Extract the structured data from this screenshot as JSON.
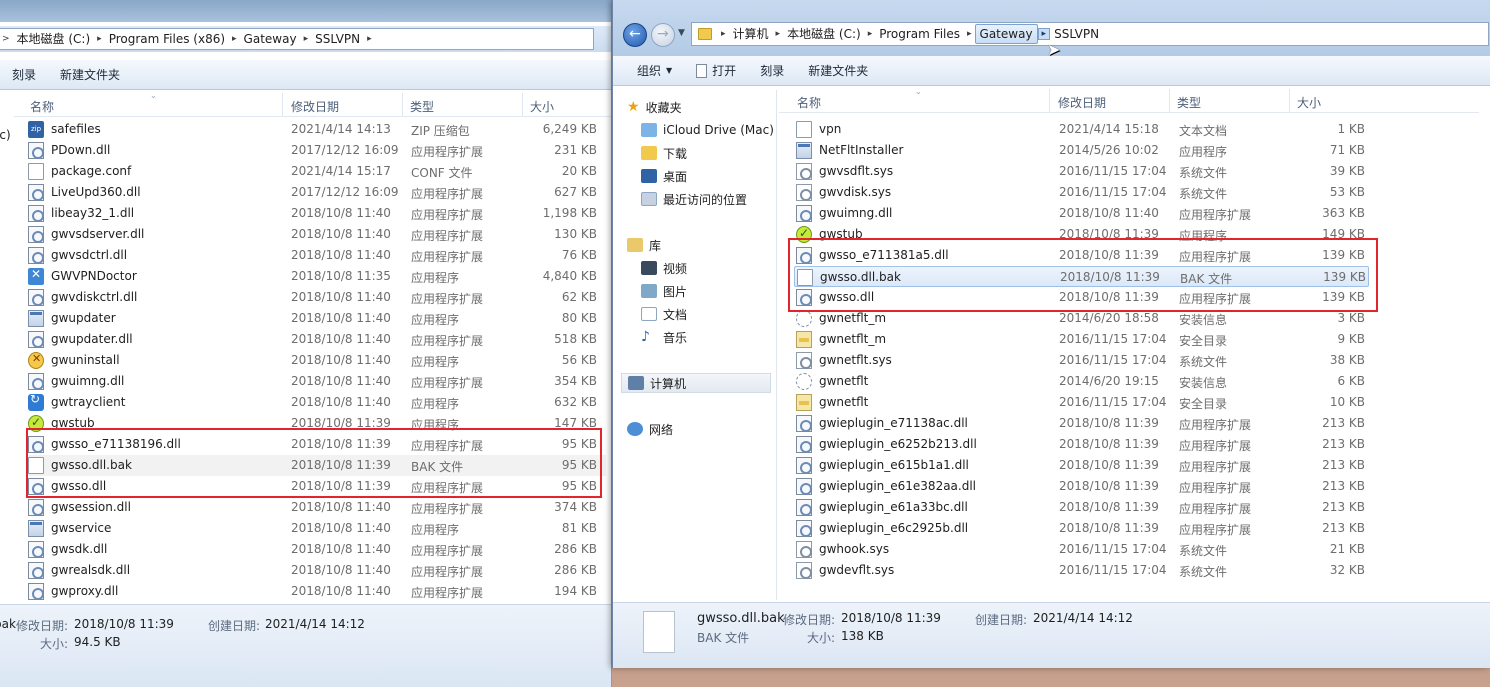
{
  "left_window": {
    "breadcrumb": [
      "本地磁盘 (C:)",
      "Program Files (x86)",
      "Gateway",
      "SSLVPN"
    ],
    "breadcrumb_lead": ">",
    "toolbar": [
      "刻录",
      "新建文件夹"
    ],
    "columns": {
      "name": "名称",
      "date": "修改日期",
      "type": "类型",
      "size": "大小"
    },
    "left_edge_text": "ac)",
    "files": [
      {
        "name": "safefiles",
        "date": "2021/4/14 14:13",
        "type": "ZIP 压缩包",
        "size": "6,249 KB",
        "icon": "zip"
      },
      {
        "name": "PDown.dll",
        "date": "2017/12/12 16:09",
        "type": "应用程序扩展",
        "size": "231 KB",
        "icon": "dll"
      },
      {
        "name": "package.conf",
        "date": "2021/4/14 15:17",
        "type": "CONF 文件",
        "size": "20 KB",
        "icon": "doc"
      },
      {
        "name": "LiveUpd360.dll",
        "date": "2017/12/12 16:09",
        "type": "应用程序扩展",
        "size": "627 KB",
        "icon": "dll"
      },
      {
        "name": "libeay32_1.dll",
        "date": "2018/10/8 11:40",
        "type": "应用程序扩展",
        "size": "1,198 KB",
        "icon": "dll"
      },
      {
        "name": "gwvsdserver.dll",
        "date": "2018/10/8 11:40",
        "type": "应用程序扩展",
        "size": "130 KB",
        "icon": "dll"
      },
      {
        "name": "gwvsdctrl.dll",
        "date": "2018/10/8 11:40",
        "type": "应用程序扩展",
        "size": "76 KB",
        "icon": "dll"
      },
      {
        "name": "GWVPNDoctor",
        "date": "2018/10/8 11:35",
        "type": "应用程序",
        "size": "4,840 KB",
        "icon": "tool"
      },
      {
        "name": "gwvdiskctrl.dll",
        "date": "2018/10/8 11:40",
        "type": "应用程序扩展",
        "size": "62 KB",
        "icon": "dll"
      },
      {
        "name": "gwupdater",
        "date": "2018/10/8 11:40",
        "type": "应用程序",
        "size": "80 KB",
        "icon": "exe"
      },
      {
        "name": "gwupdater.dll",
        "date": "2018/10/8 11:40",
        "type": "应用程序扩展",
        "size": "518 KB",
        "icon": "dll"
      },
      {
        "name": "gwuninstall",
        "date": "2018/10/8 11:40",
        "type": "应用程序",
        "size": "56 KB",
        "icon": "warn"
      },
      {
        "name": "gwuimng.dll",
        "date": "2018/10/8 11:40",
        "type": "应用程序扩展",
        "size": "354 KB",
        "icon": "dll"
      },
      {
        "name": "gwtrayclient",
        "date": "2018/10/8 11:40",
        "type": "应用程序",
        "size": "632 KB",
        "icon": "tray"
      },
      {
        "name": "gwstub",
        "date": "2018/10/8 11:39",
        "type": "应用程序",
        "size": "147 KB",
        "icon": "check"
      },
      {
        "name": "gwsso_e71138196.dll",
        "date": "2018/10/8 11:39",
        "type": "应用程序扩展",
        "size": "95 KB",
        "icon": "dll"
      },
      {
        "name": "gwsso.dll.bak",
        "date": "2018/10/8 11:39",
        "type": "BAK 文件",
        "size": "95 KB",
        "icon": "doc"
      },
      {
        "name": "gwsso.dll",
        "date": "2018/10/8 11:39",
        "type": "应用程序扩展",
        "size": "95 KB",
        "icon": "dll"
      },
      {
        "name": "gwsession.dll",
        "date": "2018/10/8 11:40",
        "type": "应用程序扩展",
        "size": "374 KB",
        "icon": "dll"
      },
      {
        "name": "gwservice",
        "date": "2018/10/8 11:40",
        "type": "应用程序",
        "size": "81 KB",
        "icon": "exe"
      },
      {
        "name": "gwsdk.dll",
        "date": "2018/10/8 11:40",
        "type": "应用程序扩展",
        "size": "286 KB",
        "icon": "dll"
      },
      {
        "name": "gwrealsdk.dll",
        "date": "2018/10/8 11:40",
        "type": "应用程序扩展",
        "size": "286 KB",
        "icon": "dll"
      },
      {
        "name": "gwproxy.dll",
        "date": "2018/10/8 11:40",
        "type": "应用程序扩展",
        "size": "194 KB",
        "icon": "dll"
      }
    ],
    "details": {
      "name": "bak",
      "modified_label": "修改日期:",
      "modified": "2018/10/8 11:39",
      "created_label": "创建日期:",
      "created": "2021/4/14 14:12",
      "size_label": "大小:",
      "size": "94.5 KB"
    }
  },
  "right_window": {
    "breadcrumb": [
      "计算机",
      "本地磁盘 (C:)",
      "Program Files",
      "Gateway",
      "SSLVPN"
    ],
    "toolbar": {
      "organize": "组织",
      "open": "打开",
      "burn": "刻录",
      "new_folder": "新建文件夹"
    },
    "nav": {
      "favorites": "收藏夹",
      "fav_items": [
        "iCloud Drive (Mac)",
        "下载",
        "桌面",
        "最近访问的位置"
      ],
      "libraries": "库",
      "lib_items": [
        "视频",
        "图片",
        "文档",
        "音乐"
      ],
      "computer": "计算机",
      "network": "网络"
    },
    "columns": {
      "name": "名称",
      "date": "修改日期",
      "type": "类型",
      "size": "大小"
    },
    "files": [
      {
        "name": "vpn",
        "date": "2021/4/14 15:18",
        "type": "文本文档",
        "size": "1 KB",
        "icon": "doc"
      },
      {
        "name": "NetFltInstaller",
        "date": "2014/5/26 10:02",
        "type": "应用程序",
        "size": "71 KB",
        "icon": "exe"
      },
      {
        "name": "gwvsdflt.sys",
        "date": "2016/11/15 17:04",
        "type": "系统文件",
        "size": "39 KB",
        "icon": "sys"
      },
      {
        "name": "gwvdisk.sys",
        "date": "2016/11/15 17:04",
        "type": "系统文件",
        "size": "53 KB",
        "icon": "sys"
      },
      {
        "name": "gwuimng.dll",
        "date": "2018/10/8 11:40",
        "type": "应用程序扩展",
        "size": "363 KB",
        "icon": "dll"
      },
      {
        "name": "gwstub",
        "date": "2018/10/8 11:39",
        "type": "应用程序",
        "size": "149 KB",
        "icon": "check"
      },
      {
        "name": "gwsso_e711381a5.dll",
        "date": "2018/10/8 11:39",
        "type": "应用程序扩展",
        "size": "139 KB",
        "icon": "dll"
      },
      {
        "name": "gwsso.dll.bak",
        "date": "2018/10/8 11:39",
        "type": "BAK 文件",
        "size": "139 KB",
        "icon": "doc"
      },
      {
        "name": "gwsso.dll",
        "date": "2018/10/8 11:39",
        "type": "应用程序扩展",
        "size": "139 KB",
        "icon": "dll"
      },
      {
        "name": "gwnetflt_m",
        "date": "2014/6/20 18:58",
        "type": "安装信息",
        "size": "3 KB",
        "icon": "inf"
      },
      {
        "name": "gwnetflt_m",
        "date": "2016/11/15 17:04",
        "type": "安全目录",
        "size": "9 KB",
        "icon": "cat"
      },
      {
        "name": "gwnetflt.sys",
        "date": "2016/11/15 17:04",
        "type": "系统文件",
        "size": "38 KB",
        "icon": "sys"
      },
      {
        "name": "gwnetflt",
        "date": "2014/6/20 19:15",
        "type": "安装信息",
        "size": "6 KB",
        "icon": "inf"
      },
      {
        "name": "gwnetflt",
        "date": "2016/11/15 17:04",
        "type": "安全目录",
        "size": "10 KB",
        "icon": "cat"
      },
      {
        "name": "gwieplugin_e71138ac.dll",
        "date": "2018/10/8 11:39",
        "type": "应用程序扩展",
        "size": "213 KB",
        "icon": "dll"
      },
      {
        "name": "gwieplugin_e6252b213.dll",
        "date": "2018/10/8 11:39",
        "type": "应用程序扩展",
        "size": "213 KB",
        "icon": "dll"
      },
      {
        "name": "gwieplugin_e615b1a1.dll",
        "date": "2018/10/8 11:39",
        "type": "应用程序扩展",
        "size": "213 KB",
        "icon": "dll"
      },
      {
        "name": "gwieplugin_e61e382aa.dll",
        "date": "2018/10/8 11:39",
        "type": "应用程序扩展",
        "size": "213 KB",
        "icon": "dll"
      },
      {
        "name": "gwieplugin_e61a33bc.dll",
        "date": "2018/10/8 11:39",
        "type": "应用程序扩展",
        "size": "213 KB",
        "icon": "dll"
      },
      {
        "name": "gwieplugin_e6c2925b.dll",
        "date": "2018/10/8 11:39",
        "type": "应用程序扩展",
        "size": "213 KB",
        "icon": "dll"
      },
      {
        "name": "gwhook.sys",
        "date": "2016/11/15 17:04",
        "type": "系统文件",
        "size": "21 KB",
        "icon": "sys"
      },
      {
        "name": "gwdevflt.sys",
        "date": "2016/11/15 17:04",
        "type": "系统文件",
        "size": "32 KB",
        "icon": "sys"
      }
    ],
    "details": {
      "name": "gwsso.dll.bak",
      "type": "BAK 文件",
      "modified_label": "修改日期:",
      "modified": "2018/10/8 11:39",
      "created_label": "创建日期:",
      "created": "2021/4/14 14:12",
      "size_label": "大小:",
      "size": "138 KB"
    }
  },
  "colors": {
    "highlight_box": "#e0262c",
    "selection": "#dae8f8"
  }
}
